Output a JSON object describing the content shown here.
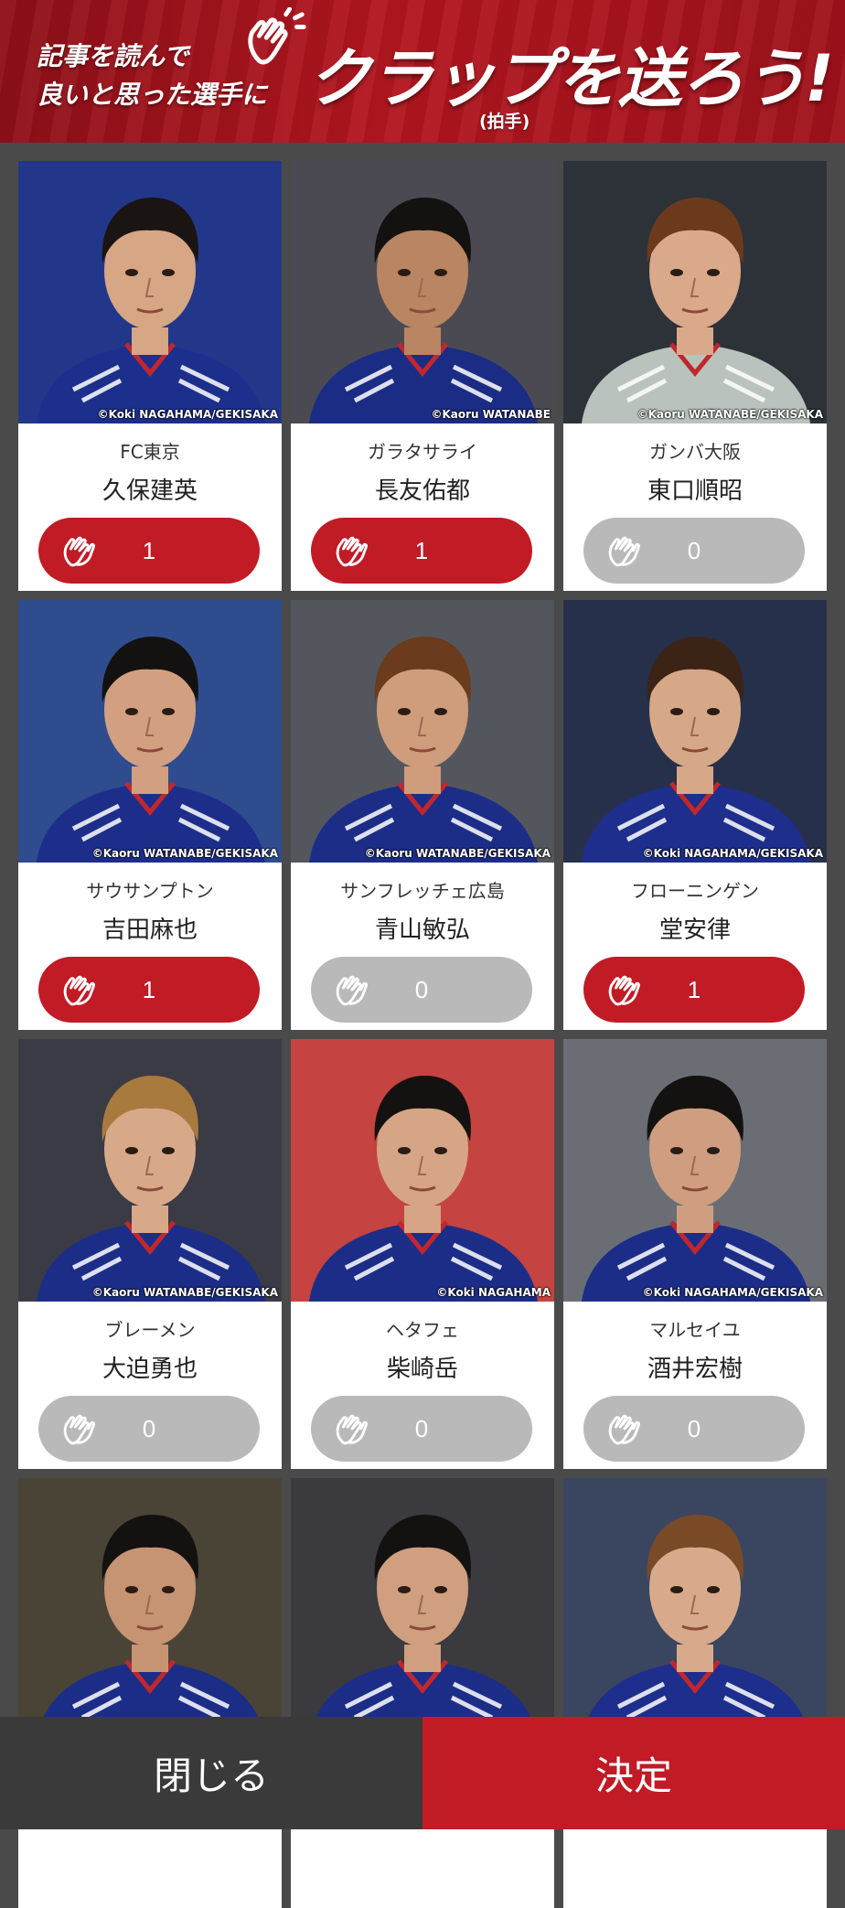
{
  "banner": {
    "line1": "記事を読んで",
    "line2": "良いと思った選手に",
    "main": "クラップを送ろう!",
    "sub": "(拍手)"
  },
  "colors": {
    "accent": "#c11b26",
    "inactive": "#b9b9b9",
    "background": "#4a4a4a"
  },
  "players": [
    {
      "team": "FC東京",
      "name": "久保建英",
      "count": "1",
      "active": true,
      "credit": "©Koki NAGAHAMA/GEKISAKA",
      "bg": "#23378a",
      "hair": "#1a1512",
      "skin": "#d7a684",
      "kit": "#1c2f8c"
    },
    {
      "team": "ガラタサライ",
      "name": "長友佑都",
      "count": "1",
      "active": true,
      "credit": "©Kaoru WATANABE",
      "bg": "#4b4a52",
      "hair": "#141211",
      "skin": "#b98562",
      "kit": "#1b2c85"
    },
    {
      "team": "ガンバ大阪",
      "name": "東口順昭",
      "count": "0",
      "active": false,
      "credit": "©Kaoru WATANABE/GEKISAKA",
      "bg": "#2d3238",
      "hair": "#6b3a1d",
      "skin": "#d9a98a",
      "kit": "#b9c2bd"
    },
    {
      "team": "サウサンプトン",
      "name": "吉田麻也",
      "count": "1",
      "active": true,
      "credit": "©Kaoru WATANABE/GEKISAKA",
      "bg": "#2f4c8e",
      "hair": "#141210",
      "skin": "#d2a080",
      "kit": "#1d2e8a"
    },
    {
      "team": "サンフレッチェ広島",
      "name": "青山敏弘",
      "count": "0",
      "active": false,
      "credit": "©Kaoru WATANABE/GEKISAKA",
      "bg": "#53575d",
      "hair": "#6a3b1c",
      "skin": "#cf9c7c",
      "kit": "#1c2d88"
    },
    {
      "team": "フローニンゲン",
      "name": "堂安律",
      "count": "1",
      "active": true,
      "credit": "©Koki NAGAHAMA/GEKISAKA",
      "bg": "#27304a",
      "hair": "#3b2416",
      "skin": "#d6a887",
      "kit": "#1d2e8c"
    },
    {
      "team": "ブレーメン",
      "name": "大迫勇也",
      "count": "0",
      "active": false,
      "credit": "©Kaoru WATANABE/GEKISAKA",
      "bg": "#3a3b45",
      "hair": "#a97a3e",
      "skin": "#d8a989",
      "kit": "#1c2d88"
    },
    {
      "team": "ヘタフェ",
      "name": "柴崎岳",
      "count": "0",
      "active": false,
      "credit": "©Koki NAGAHAMA",
      "bg": "#c54340",
      "hair": "#141210",
      "skin": "#d6a585",
      "kit": "#1c2d88"
    },
    {
      "team": "マルセイユ",
      "name": "酒井宏樹",
      "count": "0",
      "active": false,
      "credit": "©Koki NAGAHAMA/GEKISAKA",
      "bg": "#6a6e74",
      "hair": "#141210",
      "skin": "#cf9e80",
      "kit": "#1c2d88"
    },
    {
      "team": "",
      "name": "",
      "count": "",
      "active": false,
      "credit": "",
      "bg": "#4a4436",
      "hair": "#141210",
      "skin": "#c69373",
      "kit": "#1c2d88"
    },
    {
      "team": "",
      "name": "",
      "count": "",
      "active": false,
      "credit": "",
      "bg": "#3b3a3e",
      "hair": "#141210",
      "skin": "#cf9f80",
      "kit": "#1c2d88"
    },
    {
      "team": "",
      "name": "",
      "count": "",
      "active": false,
      "credit": "",
      "bg": "#3a4660",
      "hair": "#7a4a26",
      "skin": "#d8aa8b",
      "kit": "#1d2e8c"
    }
  ],
  "footer": {
    "close_label": "閉じる",
    "confirm_label": "決定"
  }
}
